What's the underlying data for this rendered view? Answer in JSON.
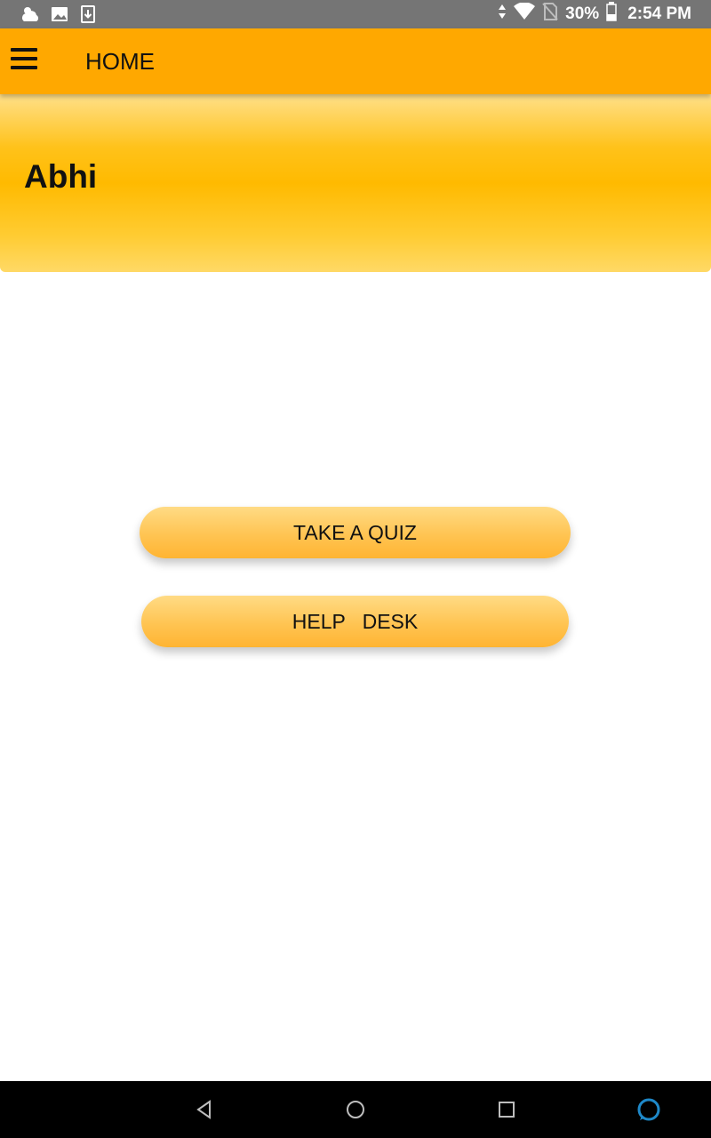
{
  "status_bar": {
    "battery": "30%",
    "time": "2:54 PM",
    "icons_left": [
      "weather-icon",
      "image-icon",
      "download-icon"
    ],
    "icons_right": [
      "data-arrows-icon",
      "wifi-icon",
      "no-sim-icon",
      "battery-icon"
    ]
  },
  "app_bar": {
    "title": "HOME",
    "menu_icon": "hamburger-menu-icon",
    "color": "#ffa800"
  },
  "banner": {
    "user_name": "Abhi"
  },
  "actions": {
    "take_quiz_label": "TAKE A QUIZ",
    "help_desk_label": "HELP   DESK"
  },
  "nav_bar": {
    "icons": [
      "back-icon",
      "home-icon",
      "recents-icon",
      "assistant-icon"
    ]
  }
}
